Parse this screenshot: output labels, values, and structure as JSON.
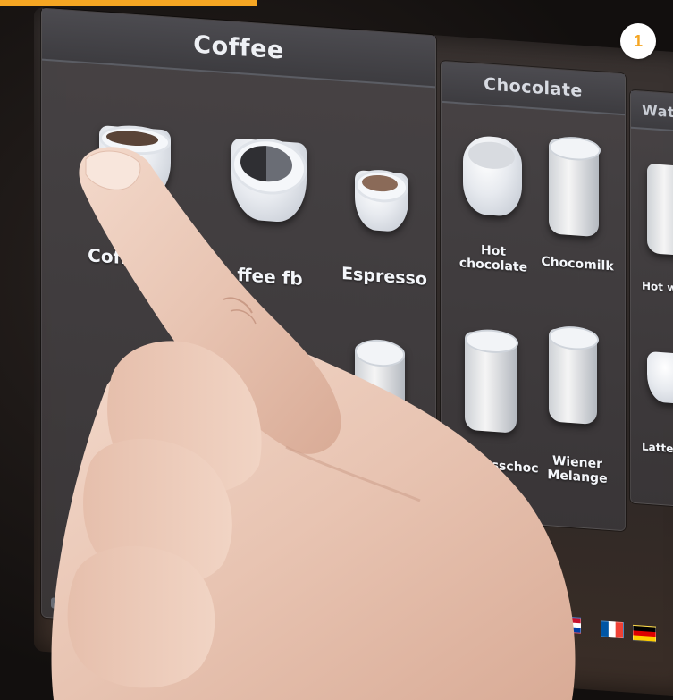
{
  "step_badge": "1",
  "panels": {
    "coffee": {
      "title": "Coffee",
      "items": [
        "Coffee Bo",
        "ffee fb",
        "Espresso"
      ]
    },
    "chocolate": {
      "title": "Chocolate",
      "items": [
        "Hot chocolate",
        "Chocomilk",
        "Espresschoc",
        "Wiener Melange"
      ]
    },
    "water": {
      "title": "Water",
      "items": [
        "Hot water",
        "LatteMac"
      ]
    }
  },
  "colors": {
    "accent": "#f5a623",
    "panel": "#3f3d42",
    "header_bar": "#4c4b50"
  }
}
